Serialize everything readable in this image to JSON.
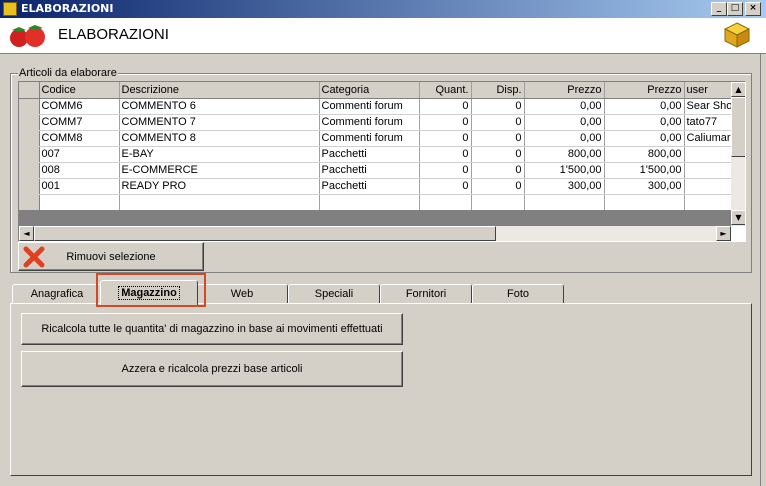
{
  "window": {
    "title": "ELABORAZIONI",
    "header_title": "ELABORAZIONI",
    "controls": {
      "minimize": "_",
      "maximize": "□",
      "close": "×"
    }
  },
  "articles_group": {
    "legend": "Articoli da elaborare",
    "columns": [
      "Codice",
      "Descrizione",
      "Categoria",
      "Quant.",
      "Disp.",
      "Prezzo",
      "Prezzo",
      "user"
    ],
    "rows": [
      [
        "COMM6",
        "COMMENTO 6",
        "Commenti forum",
        "0",
        "0",
        "0,00",
        "0,00",
        "Sear Sho"
      ],
      [
        "COMM7",
        "COMMENTO 7",
        "Commenti forum",
        "0",
        "0",
        "0,00",
        "0,00",
        "tato77"
      ],
      [
        "COMM8",
        "COMMENTO 8",
        "Commenti forum",
        "0",
        "0",
        "0,00",
        "0,00",
        "Caliumar"
      ],
      [
        "007",
        "E-BAY",
        "Pacchetti",
        "0",
        "0",
        "800,00",
        "800,00",
        ""
      ],
      [
        "008",
        "E-COMMERCE",
        "Pacchetti",
        "0",
        "0",
        "1'500,00",
        "1'500,00",
        ""
      ],
      [
        "001",
        "READY PRO",
        "Pacchetti",
        "0",
        "0",
        "300,00",
        "300,00",
        ""
      ]
    ],
    "remove_button": "Rimuovi selezione"
  },
  "tabs": [
    {
      "label": "Anagrafica",
      "active": false
    },
    {
      "label": "Magazzino",
      "active": true
    },
    {
      "label": "Web",
      "active": false
    },
    {
      "label": "Speciali",
      "active": false
    },
    {
      "label": "Fornitori",
      "active": false
    },
    {
      "label": "Foto",
      "active": false
    }
  ],
  "magazzino_panel": {
    "recalc_button": "Ricalcola tutte le quantita' di magazzino in base ai movimenti effettuati",
    "reset_button": "Azzera e ricalcola prezzi base articoli"
  },
  "colors": {
    "highlight": "#d04a2a",
    "titlebar_start": "#0a246a",
    "titlebar_end": "#a6caf0"
  }
}
